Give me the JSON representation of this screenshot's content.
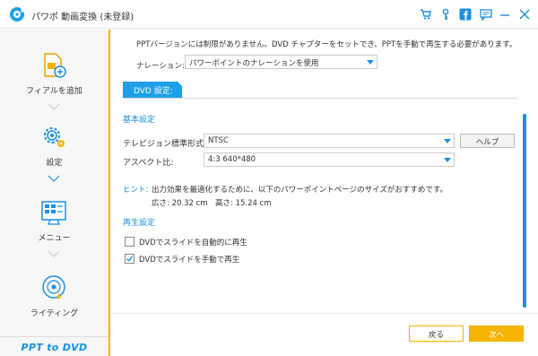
{
  "window": {
    "title": "パワポ 動画変換 (未登録)",
    "icons": [
      "cart-icon",
      "key-icon",
      "facebook-icon",
      "chat-icon",
      "minimize-icon",
      "close-icon"
    ]
  },
  "sidebar": {
    "items": [
      {
        "label": "フィアルを追加",
        "icon": "add-file-icon"
      },
      {
        "label": "設定",
        "icon": "gear-icon",
        "active": true
      },
      {
        "label": "メニュー",
        "icon": "menu-grid-icon"
      },
      {
        "label": "ライティング",
        "icon": "disc-burn-icon"
      }
    ],
    "brand": "PPT to DVD"
  },
  "main": {
    "info": "PPTバージョンには制限がありません。DVD チャプターをセットでき、PPTを手動で再生する必要があります。",
    "narration": {
      "label": "ナレーション:",
      "value": "パワーポイントのナレーションを使用"
    },
    "tab": "DVD 設定:",
    "basic_title": "基本設定",
    "tv_standard": {
      "label": "テレビジョン標準形式:",
      "value": "NTSC"
    },
    "help_label": "ヘルプ",
    "aspect": {
      "label": "アスペクト比:",
      "value": "4:3 640*480"
    },
    "hint_label": "ヒント:",
    "hint_text": "出力効果を最適化するために、以下のパワーポイントページのサイズがおすすめです。",
    "hint_size": "広さ: 20.32 cm　高さ: 15.24 cm",
    "playback_title": "再生設定",
    "auto_play": {
      "label": "DVDでスライドを自動的に再生",
      "checked": false
    },
    "manual_play": {
      "label": "DVDでスライドを手動で再生",
      "checked": true
    },
    "back_label": "戻る",
    "next_label": "次へ"
  },
  "colors": {
    "accent_blue": "#1a8fe0",
    "accent_orange": "#f5b400"
  }
}
